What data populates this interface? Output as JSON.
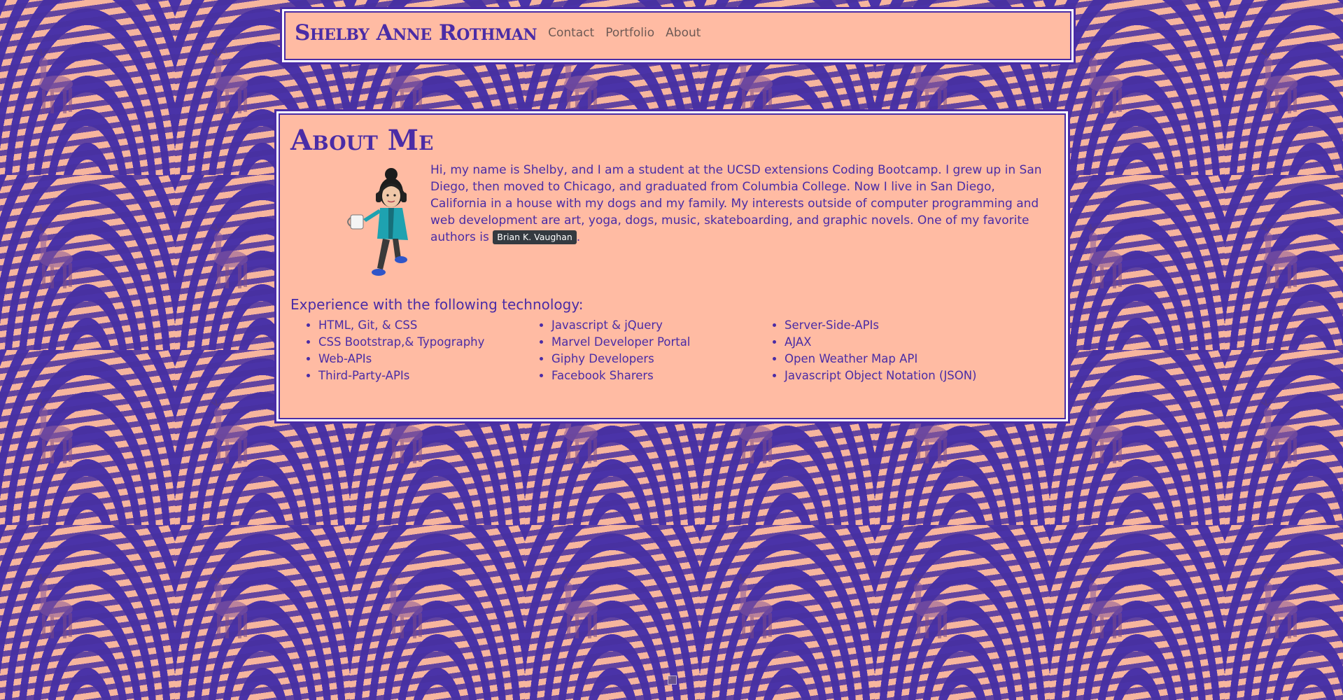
{
  "navbar": {
    "brand": "Shelby Anne Rothman",
    "links": [
      "Contact",
      "Portfolio",
      "About"
    ]
  },
  "about": {
    "heading": "About Me",
    "bio_text": "Hi, my name is Shelby, and I am a student at the UCSD extensions Coding Bootcamp. I grew up in San Diego, then moved to Chicago, and graduated from Columbia College. Now I live in San Diego, California in a house with my dogs and my family. My interests outside of computer programming and web development are art, yoga, dogs, music, skateboarding, and graphic novels. One of my favorite authors is ",
    "favorite_author": "Brian K. Vaughan",
    "bio_end": ".",
    "avatar_icon": "bitmoji-avatar-icon"
  },
  "experience": {
    "title": "Experience with the following technology:",
    "columns": [
      [
        "HTML, Git, & CSS",
        "CSS Bootstrap,& Typography",
        "Web-APIs",
        "Third-Party-APIs"
      ],
      [
        "Javascript & jQuery",
        "Marvel Developer Portal",
        "Giphy Developers",
        "Facebook Sharers"
      ],
      [
        "Server-Side-APIs",
        "AJAX",
        "Open Weather Map API",
        "Javascript Object Notation (JSON)"
      ]
    ]
  },
  "colors": {
    "accent": "#4a2ca6",
    "panel": "#ffbba3",
    "badge": "#343a40"
  }
}
